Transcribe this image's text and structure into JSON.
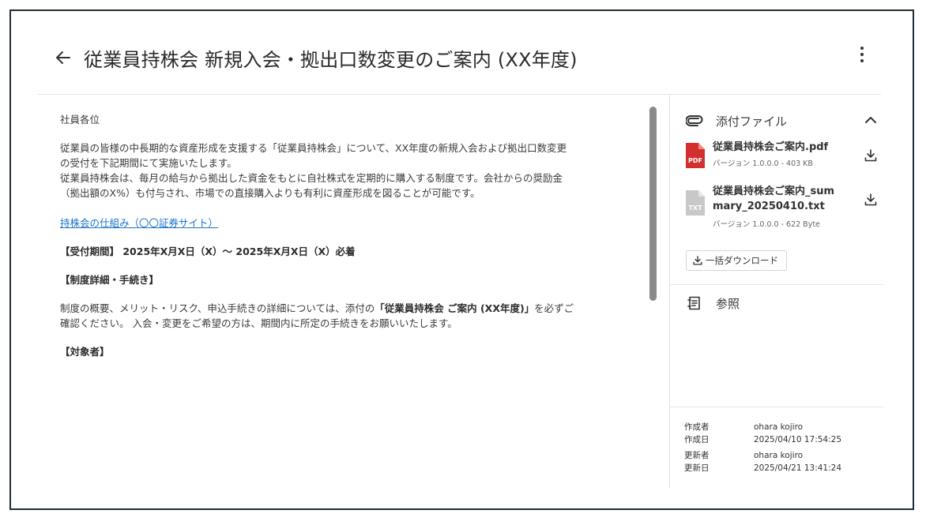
{
  "header": {
    "title": "従業員持株会 新規入会・拠出口数変更のご案内 (XX年度)"
  },
  "body": {
    "greeting": "社員各位",
    "para1_line1": "従業員の皆様の中長期的な資産形成を支援する「従業員持株会」について、XX年度の新規入会および拠出口数変更",
    "para1_line2": "の受付を下記期間にて実施いたします。",
    "para1_line3": "従業員持株会は、毎月の給与から拠出した資金をもとに自社株式を定期的に購入する制度です。会社からの奨励金",
    "para1_line4": "（拠出額のX%）も付与され、市場での直接購入よりも有利に資産形成を図ることが可能です。",
    "link_text": "持株会の仕組み（〇〇証券サイト）",
    "period": "【受付期間】 2025年X月X日（X）～ 2025年X月X日（X）必着",
    "details_heading": "【制度詳細・手続き】",
    "para2_pre": "制度の概要、メリット・リスク、申込手続きの詳細については、添付の",
    "para2_bold": "「従業員持株会 ご案内 (XX年度)」",
    "para2_post": "を必ずご",
    "para2_line2": "確認ください。 入会・変更をご希望の方は、期間内に所定の手続きをお願いいたします。",
    "target_heading": "【対象者】"
  },
  "attachments": {
    "label": "添付ファイル",
    "files": [
      {
        "name": "従業員持株会ご案内.pdf",
        "version": "バージョン 1.0.0.0 - 403 KB",
        "type": "PDF",
        "icon_color": "#d32f2f"
      },
      {
        "name": "従業員持株会ご案内_summary_20250410.txt",
        "version": "バージョン 1.0.0.0 - 622 Byte",
        "type": "TXT",
        "icon_color": "#c8c8c8"
      }
    ],
    "bulk_download_label": "一括ダウンロード"
  },
  "reference": {
    "label": "参照"
  },
  "meta": {
    "created_by_label": "作成者",
    "created_by": "ohara kojiro",
    "created_at_label": "作成日",
    "created_at": "2025/04/10 17:54:25",
    "updated_by_label": "更新者",
    "updated_by": "ohara kojiro",
    "updated_at_label": "更新日",
    "updated_at": "2025/04/21 13:41:24"
  }
}
